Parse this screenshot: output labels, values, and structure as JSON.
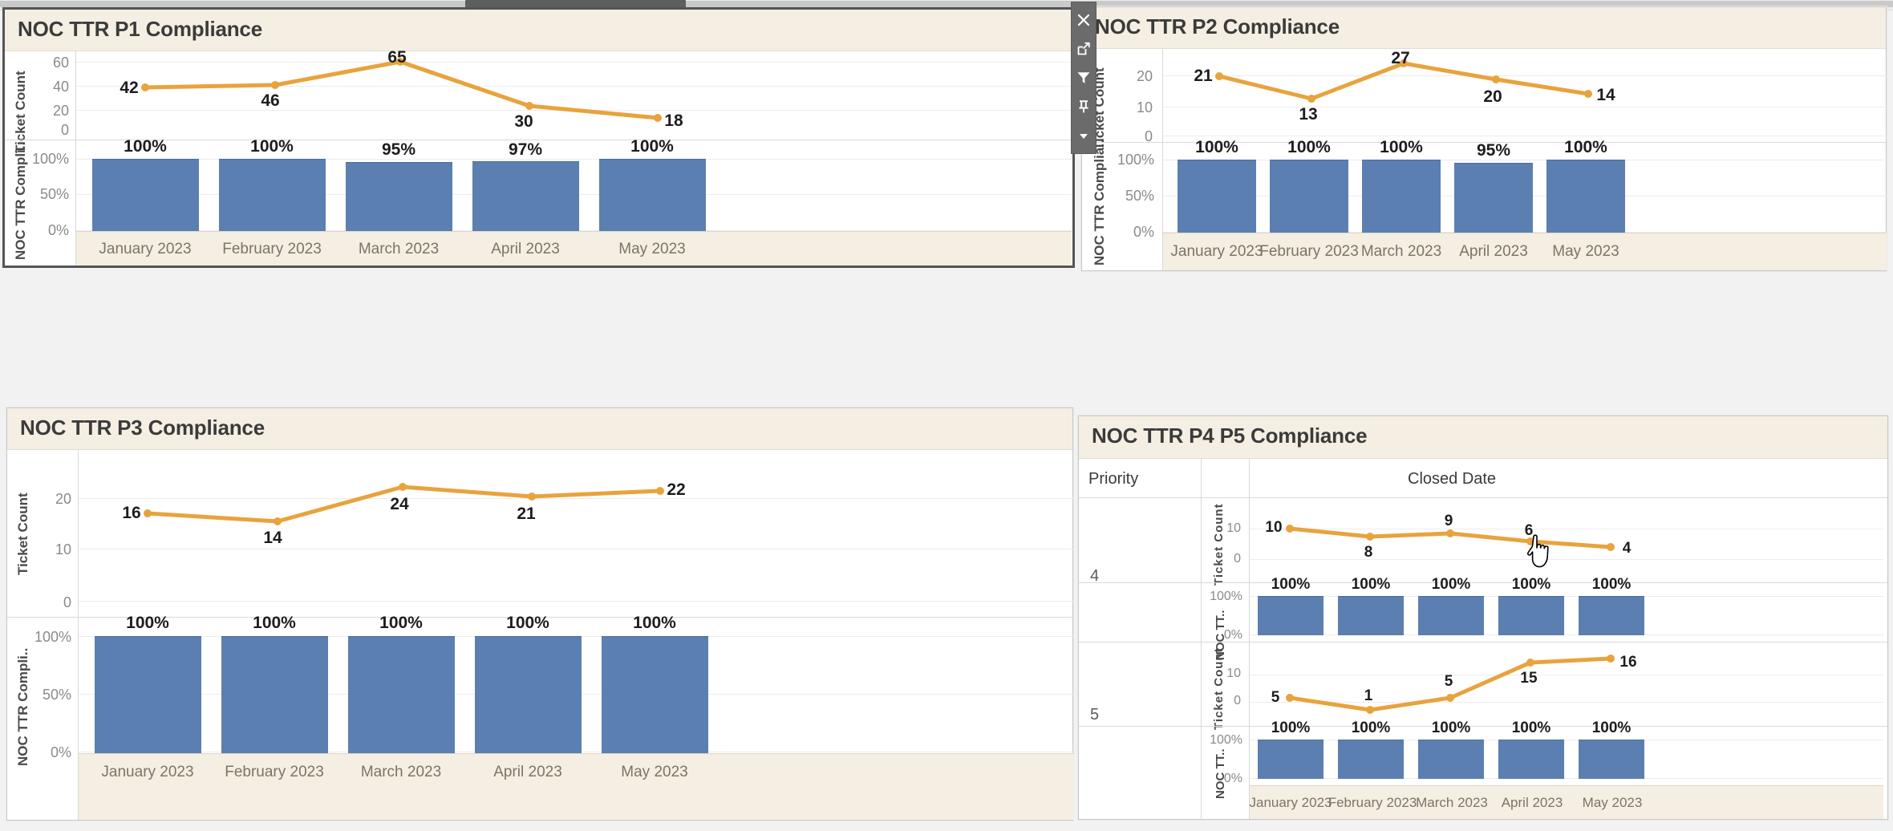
{
  "window": {
    "scrollbar": {
      "name": "horizontal-scrollbar"
    }
  },
  "toolbar": {
    "items": [
      {
        "id": "close",
        "icon": "close-icon",
        "label": "Close"
      },
      {
        "id": "export",
        "icon": "export-icon",
        "label": "Open in new window"
      },
      {
        "id": "filter",
        "icon": "filter-icon",
        "label": "Filter"
      },
      {
        "id": "pin",
        "icon": "pin-icon",
        "label": "Pin"
      },
      {
        "id": "more",
        "icon": "chevron-down-icon",
        "label": "More options"
      }
    ]
  },
  "panels": {
    "p1": {
      "title": "NOC TTR P1 Compliance",
      "selected": true
    },
    "p2": {
      "title": "NOC TTR P2 Compliance",
      "selected": false
    },
    "p3": {
      "title": "NOC TTR P3 Compliance",
      "selected": false
    },
    "p45": {
      "title": "NOC TTR P4 P5 Compliance",
      "selected": false
    }
  },
  "matrix": {
    "priority_header": "Priority",
    "closed_date_header": "Closed Date",
    "rows": [
      {
        "priority": "4"
      },
      {
        "priority": "5"
      }
    ]
  },
  "axes": {
    "ticket_count": "Ticket Count",
    "ticket_count_short": "Ticket Count",
    "compliance_p1": "NOC TTR Compli..",
    "compliance_p2": "NOC TTR Complia..",
    "compliance_p3": "NOC TTR Compli..",
    "compliance_short": "NOC TT..",
    "months": [
      "January 2023",
      "February 2023",
      "March 2023",
      "April 2023",
      "May 2023"
    ]
  },
  "colors": {
    "line": "#e8a33d",
    "bar": "#5b7fb0",
    "title_bg": "#f4efe2",
    "axis_band": "#f4efe2",
    "toolbar_bg": "#6b6b6b"
  },
  "chart_data": [
    {
      "id": "p1-ticket-count",
      "type": "line",
      "title": "NOC TTR P1 Compliance",
      "xlabel": "",
      "ylabel": "Ticket Count",
      "categories": [
        "January 2023",
        "February 2023",
        "March 2023",
        "April 2023",
        "May 2023"
      ],
      "values": [
        42,
        46,
        65,
        30,
        18
      ],
      "labels": [
        "42",
        "46",
        "65",
        "30",
        "18"
      ],
      "yticks": [
        0,
        20,
        40,
        60
      ],
      "ylim": [
        0,
        70
      ],
      "grid": true,
      "legend": "none"
    },
    {
      "id": "p1-compliance",
      "type": "bar",
      "title": "NOC TTR P1 Compliance",
      "xlabel": "",
      "ylabel": "NOC TTR Compli..",
      "categories": [
        "January 2023",
        "February 2023",
        "March 2023",
        "April 2023",
        "May 2023"
      ],
      "values": [
        100,
        100,
        95,
        97,
        100
      ],
      "labels": [
        "100%",
        "100%",
        "95%",
        "97%",
        "100%"
      ],
      "yticks": [
        "0%",
        "50%",
        "100%"
      ],
      "ylim": [
        0,
        100
      ],
      "grid": true,
      "legend": "none"
    },
    {
      "id": "p2-ticket-count",
      "type": "line",
      "title": "NOC TTR P2 Compliance",
      "xlabel": "",
      "ylabel": "Ticket Count",
      "categories": [
        "January 2023",
        "February 2023",
        "March 2023",
        "April 2023",
        "May 2023"
      ],
      "values": [
        21,
        13,
        27,
        20,
        14
      ],
      "labels": [
        "21",
        "13",
        "27",
        "20",
        "14"
      ],
      "yticks": [
        0,
        10,
        20
      ],
      "ylim": [
        0,
        30
      ],
      "grid": true,
      "legend": "none"
    },
    {
      "id": "p2-compliance",
      "type": "bar",
      "title": "NOC TTR P2 Compliance",
      "xlabel": "",
      "ylabel": "NOC TTR Complia..",
      "categories": [
        "January 2023",
        "February 2023",
        "March 2023",
        "April 2023",
        "May 2023"
      ],
      "values": [
        100,
        100,
        100,
        95,
        100
      ],
      "labels": [
        "100%",
        "100%",
        "100%",
        "95%",
        "100%"
      ],
      "yticks": [
        "0%",
        "50%",
        "100%"
      ],
      "ylim": [
        0,
        100
      ],
      "grid": true,
      "legend": "none"
    },
    {
      "id": "p3-ticket-count",
      "type": "line",
      "title": "NOC TTR P3 Compliance",
      "xlabel": "",
      "ylabel": "Ticket Count",
      "categories": [
        "January 2023",
        "February 2023",
        "March 2023",
        "April 2023",
        "May 2023"
      ],
      "values": [
        16,
        14,
        24,
        21,
        22
      ],
      "labels": [
        "16",
        "14",
        "24",
        "21",
        "22"
      ],
      "yticks": [
        0,
        10,
        20
      ],
      "ylim": [
        0,
        27
      ],
      "grid": true,
      "legend": "none"
    },
    {
      "id": "p3-compliance",
      "type": "bar",
      "title": "NOC TTR P3 Compliance",
      "xlabel": "",
      "ylabel": "NOC TTR Compli..",
      "categories": [
        "January 2023",
        "February 2023",
        "March 2023",
        "April 2023",
        "May 2023"
      ],
      "values": [
        100,
        100,
        100,
        100,
        100
      ],
      "labels": [
        "100%",
        "100%",
        "100%",
        "100%",
        "100%"
      ],
      "yticks": [
        "0%",
        "50%",
        "100%"
      ],
      "ylim": [
        0,
        100
      ],
      "grid": true,
      "legend": "none"
    },
    {
      "id": "p4-ticket-count",
      "type": "line",
      "title": "NOC TTR P4 P5 Compliance — Priority 4",
      "xlabel": "Closed Date",
      "ylabel": "Ticket Count",
      "categories": [
        "January 2023",
        "February 2023",
        "March 2023",
        "April 2023",
        "May 2023"
      ],
      "values": [
        10,
        8,
        9,
        6,
        4
      ],
      "labels": [
        "10",
        "8",
        "9",
        "6",
        "4"
      ],
      "yticks": [
        0,
        10
      ],
      "ylim": [
        0,
        12
      ],
      "grid": true,
      "legend": "none"
    },
    {
      "id": "p4-compliance",
      "type": "bar",
      "title": "NOC TTR P4 P5 Compliance — Priority 4",
      "xlabel": "Closed Date",
      "ylabel": "NOC TT..",
      "categories": [
        "January 2023",
        "February 2023",
        "March 2023",
        "April 2023",
        "May 2023"
      ],
      "values": [
        100,
        100,
        100,
        100,
        100
      ],
      "labels": [
        "100%",
        "100%",
        "100%",
        "100%",
        "100%"
      ],
      "yticks": [
        "0%",
        "100%"
      ],
      "ylim": [
        0,
        100
      ],
      "grid": true,
      "legend": "none"
    },
    {
      "id": "p5-ticket-count",
      "type": "line",
      "title": "NOC TTR P4 P5 Compliance — Priority 5",
      "xlabel": "Closed Date",
      "ylabel": "Ticket Count",
      "categories": [
        "January 2023",
        "February 2023",
        "March 2023",
        "April 2023",
        "May 2023"
      ],
      "values": [
        5,
        1,
        5,
        15,
        16
      ],
      "labels": [
        "5",
        "1",
        "5",
        "15",
        "16"
      ],
      "yticks": [
        0,
        10
      ],
      "ylim": [
        0,
        18
      ],
      "grid": true,
      "legend": "none"
    },
    {
      "id": "p5-compliance",
      "type": "bar",
      "title": "NOC TTR P4 P5 Compliance — Priority 5",
      "xlabel": "Closed Date",
      "ylabel": "NOC TT..",
      "categories": [
        "January 2023",
        "February 2023",
        "March 2023",
        "April 2023",
        "May 2023"
      ],
      "values": [
        100,
        100,
        100,
        100,
        100
      ],
      "labels": [
        "100%",
        "100%",
        "100%",
        "100%",
        "100%"
      ],
      "yticks": [
        "0%",
        "100%"
      ],
      "ylim": [
        0,
        100
      ],
      "grid": true,
      "legend": "none"
    }
  ]
}
